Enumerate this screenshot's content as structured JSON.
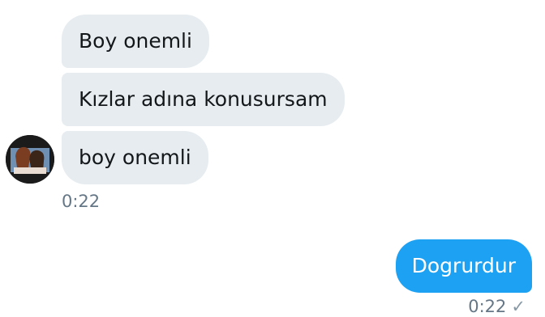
{
  "conversation": {
    "incoming": [
      {
        "text": "Boy onemli"
      },
      {
        "text": "Kızlar adına konusursam"
      },
      {
        "text": "boy onemli"
      }
    ],
    "incoming_time": "0:22",
    "outgoing": [
      {
        "text": "Dogrurdur"
      }
    ],
    "outgoing_time": "0:22"
  },
  "icons": {
    "avatar": "user-avatar-photo",
    "read_receipt": "check-icon"
  },
  "colors": {
    "incoming_bubble": "#e6ecf0",
    "outgoing_bubble": "#1da1f2",
    "timestamp": "#657786"
  }
}
